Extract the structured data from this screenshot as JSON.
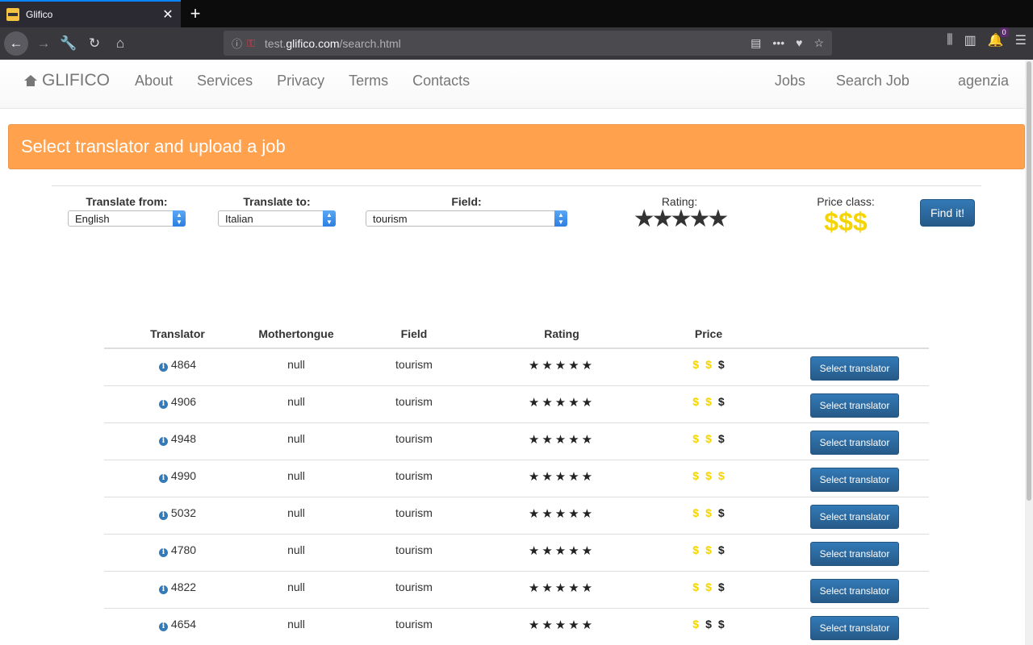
{
  "browser": {
    "tab_title": "Glifico",
    "url_prefix": "test.",
    "url_domain": "glifico.com",
    "url_path": "/search.html",
    "notification_count": "0"
  },
  "site": {
    "brand": "GLIFICO",
    "nav_left": [
      "About",
      "Services",
      "Privacy",
      "Terms",
      "Contacts"
    ],
    "nav_right": [
      "Jobs",
      "Search Job"
    ],
    "user": "agenzia"
  },
  "banner": {
    "title": "Select translator and upload a job"
  },
  "filters": {
    "from_label": "Translate from:",
    "from_value": "English",
    "to_label": "Translate to:",
    "to_value": "Italian",
    "field_label": "Field:",
    "field_value": "tourism",
    "rating_label": "Rating:",
    "rating_value": 5,
    "price_label": "Price class:",
    "price_value": "$$$",
    "find_button": "Find it!"
  },
  "table": {
    "headers": [
      "Translator",
      "Mothertongue",
      "Field",
      "Rating",
      "Price",
      ""
    ],
    "button_label": "Select translator",
    "rows": [
      {
        "id": "4864",
        "mothertongue": "null",
        "field": "tourism",
        "rating": 5,
        "price": 2
      },
      {
        "id": "4906",
        "mothertongue": "null",
        "field": "tourism",
        "rating": 5,
        "price": 2
      },
      {
        "id": "4948",
        "mothertongue": "null",
        "field": "tourism",
        "rating": 5,
        "price": 2
      },
      {
        "id": "4990",
        "mothertongue": "null",
        "field": "tourism",
        "rating": 5,
        "price": 3
      },
      {
        "id": "5032",
        "mothertongue": "null",
        "field": "tourism",
        "rating": 5,
        "price": 2
      },
      {
        "id": "4780",
        "mothertongue": "null",
        "field": "tourism",
        "rating": 5,
        "price": 2
      },
      {
        "id": "4822",
        "mothertongue": "null",
        "field": "tourism",
        "rating": 5,
        "price": 2
      },
      {
        "id": "4654",
        "mothertongue": "null",
        "field": "tourism",
        "rating": 5,
        "price": 1
      }
    ]
  },
  "colors": {
    "banner": "#ffa14d",
    "primary": "#337ab7",
    "price_on": "#f5d400"
  }
}
